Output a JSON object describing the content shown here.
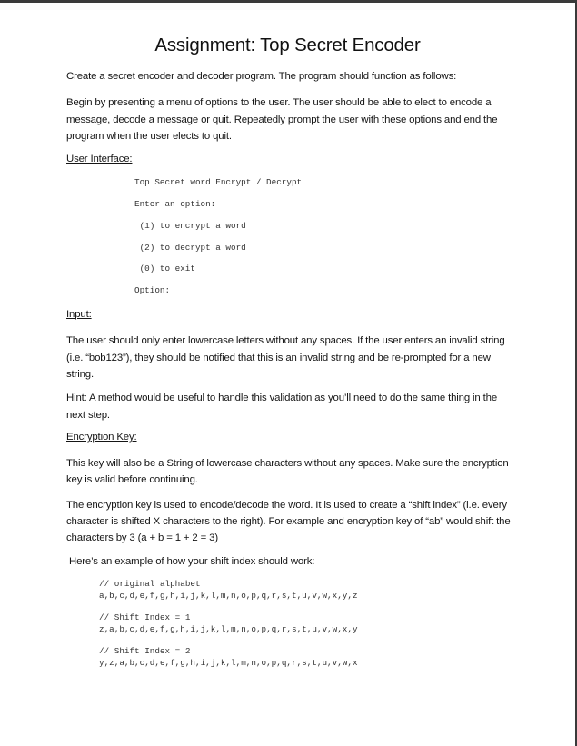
{
  "document": {
    "title": "Assignment: Top Secret Encoder",
    "intro": "Create a secret encoder and decoder program.  The program should function as follows:",
    "menu_description": "Begin by presenting a menu of options to the user.  The user should be able to elect to encode a message, decode a message or quit.  Repeatedly prompt the user with these options and end the program when the user elects to quit.",
    "sections": {
      "user_interface": {
        "heading": "User Interface:",
        "console_lines": [
          "Top Secret word Encrypt / Decrypt",
          "Enter an option:",
          " (1) to encrypt a word",
          " (2) to decrypt a word",
          " (0) to exit",
          "Option:"
        ]
      },
      "input": {
        "heading": "Input:",
        "paragraph": "The user should only enter lowercase letters without any spaces.  If the user enters an invalid string (i.e. “bob123”), they should be notified that this is an invalid string and be re-prompted for a new string.",
        "hint": "Hint: A method would be useful to handle this validation as you’ll need to do the same thing in the next step."
      },
      "encryption_key": {
        "heading": "Encryption Key:",
        "paragraph1": "This key will also be a String of lowercase characters without any spaces.  Make sure the encryption key is valid before continuing.",
        "paragraph2": "The encryption key is used to encode/decode the word.  It is used to create a “shift index” (i.e. every character is shifted X characters to the right).  For example and encryption key of “ab” would shift the characters by 3 (a + b = 1 + 2 = 3)",
        "example_intro": " Here’s an example of how your shift index should work:",
        "examples": [
          {
            "comment": "// original alphabet",
            "letters": "a,b,c,d,e,f,g,h,i,j,k,l,m,n,o,p,q,r,s,t,u,v,w,x,y,z"
          },
          {
            "comment": "// Shift Index = 1",
            "letters": "z,a,b,c,d,e,f,g,h,i,j,k,l,m,n,o,p,q,r,s,t,u,v,w,x,y"
          },
          {
            "comment": "// Shift Index = 2",
            "letters": "y,z,a,b,c,d,e,f,g,h,i,j,k,l,m,n,o,p,q,r,s,t,u,v,w,x"
          }
        ]
      }
    }
  }
}
